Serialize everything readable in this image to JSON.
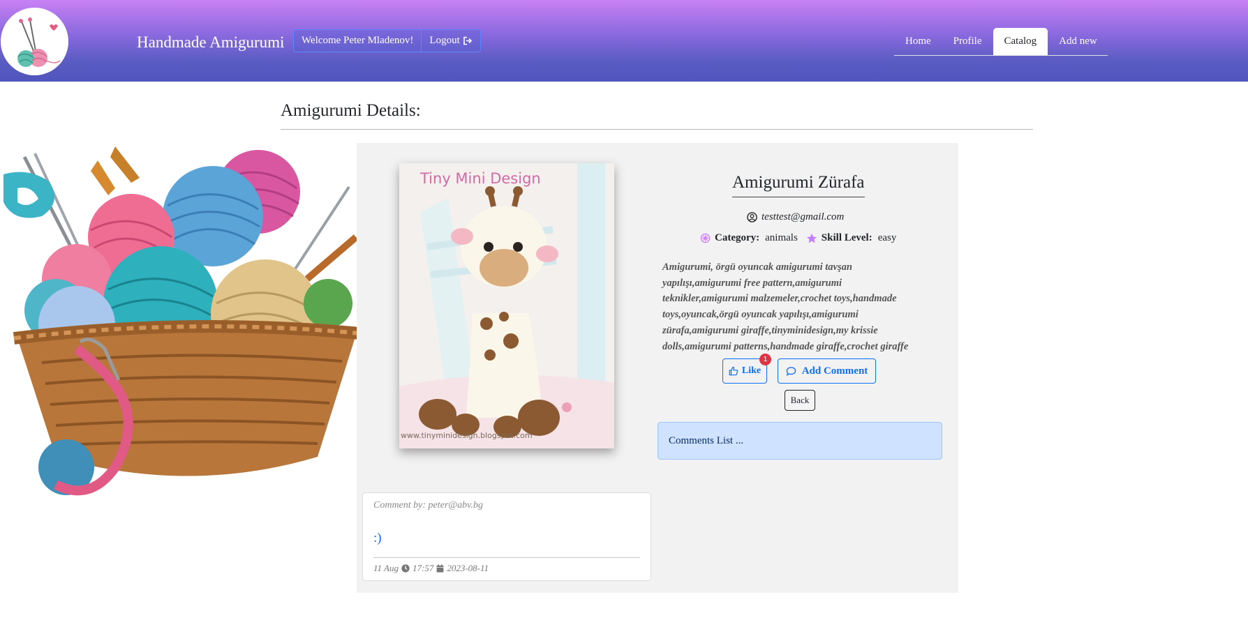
{
  "header": {
    "brand": "Handmade Amigurumi",
    "welcome": "Welcome Peter Mladenov!",
    "logout": "Logout",
    "nav": [
      "Home",
      "Profile",
      "Catalog",
      "Add new"
    ],
    "active_tab": "Catalog"
  },
  "page": {
    "title": "Amigurumi Details:"
  },
  "item": {
    "image_caption": "Tiny Mini Design",
    "image_url_text": "www.tinyminidesign.blogspot.com",
    "title": "Amigurumi Zürafa",
    "owner": "testtest@gmail.com",
    "category_label": "Category:",
    "category": "animals",
    "skill_label": "Skill Level:",
    "skill": "easy",
    "description": "Amigurumi, örgü oyuncak amigurumi tavşan yapılışı,amigurumi free pattern,amigurumi teknikler,amigurumi malzemeler,crochet toys,handmade toys,oyuncak,örgü oyuncak yapılışı,amigurumi zürafa,amigurumi giraffe,tinyminidesign,my krissie dolls,amigurumi patterns,handmade giraffe,crochet giraffe"
  },
  "actions": {
    "like": "Like",
    "like_count": "1",
    "add_comment": "Add Comment",
    "back": "Back"
  },
  "comments": {
    "list_label": "Comments List ...",
    "items": [
      {
        "author": "Comment by: peter@abv.bg",
        "text": ":)",
        "day": "11 Aug",
        "time": "17:57",
        "date": "2023-08-11"
      }
    ]
  },
  "colors": {
    "header_top": "#c881f4",
    "header_bottom": "#4f55bd",
    "primary": "#0d6efd",
    "badge": "#dc3545",
    "comments_bg": "#cfe2ff",
    "card_bg": "#f2f2f2"
  }
}
